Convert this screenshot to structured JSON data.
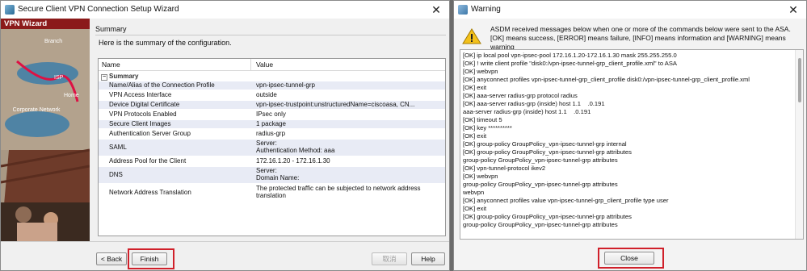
{
  "wizard": {
    "title": "Secure Client VPN Connection Setup Wizard",
    "side_header": "VPN Wizard",
    "side_labels": [
      "Branch",
      "ISP",
      "Home",
      "Corporate Network"
    ],
    "summary_heading": "Summary",
    "summary_description": "Here is the summary of the configuration.",
    "columns": [
      "Name",
      "Value"
    ],
    "group_label": "Summary",
    "rows": [
      {
        "name": "Name/Alias of the Connection Profile",
        "value": "vpn-ipsec-tunnel-grp"
      },
      {
        "name": "VPN Access Interface",
        "value": "outside"
      },
      {
        "name": "Device Digital Certificate",
        "value": "vpn-ipsec-trustpoint:unstructuredName=ciscoasa, CN..."
      },
      {
        "name": "VPN Protocols Enabled",
        "value": "IPsec only"
      },
      {
        "name": "Secure Client Images",
        "value": "1 package"
      },
      {
        "name": "Authentication Server Group",
        "value": "radius-grp"
      },
      {
        "name": "SAML",
        "value": "Server:",
        "value2": "Authentication Method: aaa"
      },
      {
        "name": "Address Pool for the Client",
        "value": "172.16.1.20 - 172.16.1.30"
      },
      {
        "name": "DNS",
        "value": "Server:",
        "value2": "Domain Name:"
      },
      {
        "name": "Network Address Translation",
        "value": "The protected traffic can be subjected to network address",
        "value2": "translation"
      }
    ],
    "buttons": {
      "back": "< Back",
      "finish": "Finish",
      "cancel": "取消",
      "help": "Help"
    }
  },
  "warning": {
    "title": "Warning",
    "message": "ASDM received messages below when one or more of the commands below were sent to the ASA. [OK] means success, [ERROR] means failure, [INFO] means information and [WARNING] means warning",
    "log": [
      "[OK] ip local pool vpn-ipsec-pool 172.16.1.20-172.16.1.30 mask 255.255.255.0",
      "[OK] ! write client profile \"disk0:/vpn-ipsec-tunnel-grp_client_profile.xml\" to ASA",
      "[OK] webvpn",
      "[OK]   anyconnect profiles vpn-ipsec-tunnel-grp_client_profile disk0:/vpn-ipsec-tunnel-grp_client_profile.xml",
      "[OK] exit",
      "[OK] aaa-server radius-grp protocol radius",
      "[OK] aaa-server radius-grp (inside) host 1.1  .0.191",
      "      aaa-server radius-grp (inside) host 1.1  .0.191",
      "[OK] timeout 5",
      "[OK] key **********",
      "[OK] exit",
      "[OK] group-policy GroupPolicy_vpn-ipsec-tunnel-grp internal",
      "[OK] group-policy GroupPolicy_vpn-ipsec-tunnel-grp attributes",
      "      group-policy GroupPolicy_vpn-ipsec-tunnel-grp attributes",
      "[OK] vpn-tunnel-protocol ikev2",
      "[OK] webvpn",
      "      group-policy GroupPolicy_vpn-ipsec-tunnel-grp attributes",
      "          webvpn",
      "[OK] anyconnect profiles value vpn-ipsec-tunnel-grp_client_profile type user",
      "[OK] exit",
      "[OK] group-policy GroupPolicy_vpn-ipsec-tunnel-grp attributes",
      "      group-policy GroupPolicy_vpn-ipsec-tunnel-grp attributes"
    ],
    "buttons": {
      "close": "Close"
    }
  },
  "colors": {
    "highlight": "#d0202a",
    "side_header": "#8b1a1a"
  },
  "icons": [
    "wizard-icon",
    "close-icon",
    "warning-icon",
    "asdm-icon"
  ]
}
